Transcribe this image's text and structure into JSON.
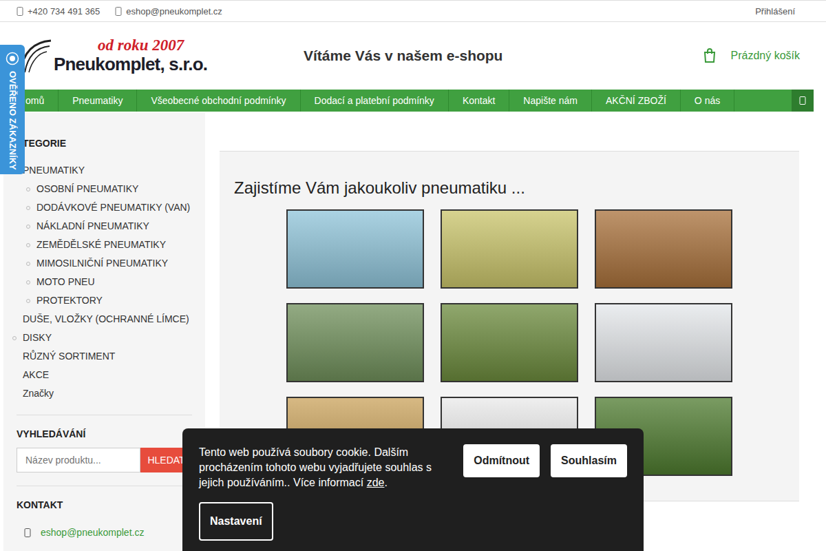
{
  "topbar": {
    "phone": "+420 734 491 365",
    "email": "eshop@pneukomplet.cz",
    "login": "Přihlášení"
  },
  "logo": {
    "tagline": "od roku 2007",
    "name": "Pneukomplet, s.r.o."
  },
  "header": {
    "welcome": "Vítáme Vás v našem e-shopu",
    "cart": "Prázdný košík"
  },
  "badge": {
    "label": "OVĚŘENO ZÁKAZNÍKY"
  },
  "nav": {
    "items": [
      {
        "label": "omů",
        "selected": false
      },
      {
        "label": "Pneumatiky",
        "selected": false
      },
      {
        "label": "Všeobecné obchodní podmínky",
        "selected": false
      },
      {
        "label": "Dodací a platební podmínky",
        "selected": false
      },
      {
        "label": "Kontakt",
        "selected": false
      },
      {
        "label": "Napište nám",
        "selected": false
      },
      {
        "label": "AKČNÍ ZBOŽÍ",
        "selected": false
      },
      {
        "label": "O nás",
        "selected": false
      }
    ]
  },
  "sidebar": {
    "categories_title": "ATEGORIE",
    "categories": [
      {
        "label": "PNEUMATIKY",
        "has_children": true,
        "expanded": true,
        "children": [
          {
            "label": "OSOBNÍ PNEUMATIKY",
            "has_children": true
          },
          {
            "label": "DODÁVKOVÉ PNEUMATIKY (VAN)",
            "has_children": true
          },
          {
            "label": "NÁKLADNÍ PNEUMATIKY",
            "has_children": true
          },
          {
            "label": "ZEMĚDĚLSKÉ PNEUMATIKY",
            "has_children": true
          },
          {
            "label": "MIMOSILNIČNÍ PNEUMATIKY",
            "has_children": true
          },
          {
            "label": "MOTO PNEU",
            "has_children": true
          },
          {
            "label": "PROTEKTORY",
            "has_children": true
          }
        ]
      },
      {
        "label": "DUŠE, VLOŽKY (OCHRANNÉ LÍMCE)",
        "has_children": false,
        "expanded": false,
        "children": []
      },
      {
        "label": "DISKY",
        "has_children": true,
        "expanded": false,
        "children": []
      },
      {
        "label": "RŮZNÝ SORTIMENT",
        "has_children": false,
        "expanded": false,
        "children": []
      },
      {
        "label": "AKCE",
        "has_children": false,
        "expanded": false,
        "children": []
      },
      {
        "label": "Značky",
        "has_children": false,
        "expanded": false,
        "children": []
      }
    ],
    "search_title": "VYHLEDÁVÁNÍ",
    "search_placeholder": "Název produktu...",
    "search_button": "HLEDAT",
    "contact_title": "KONTAKT",
    "contact_email": "eshop@pneukomplet.cz"
  },
  "main": {
    "heading": "Zajistíme Vám jakoukoliv pneumatiku ...",
    "tiles": [
      {
        "color": "#8fc4d9"
      },
      {
        "color": "#c9c46a"
      },
      {
        "color": "#a8703a"
      },
      {
        "color": "#6f8f5a"
      },
      {
        "color": "#6b8a3c"
      },
      {
        "color": "#e4e7ea"
      },
      {
        "color": "#c9a15a"
      },
      {
        "color": "#e9e9e9"
      },
      {
        "color": "#4d7a2e"
      }
    ]
  },
  "cookie": {
    "text": "Tento web používá soubory cookie. Dalším procházením tohoto webu vyjadřujete souhlas s jejich používáním.. Více informací ",
    "link": "zde",
    "after": ".",
    "reject": "Odmítnout",
    "accept": "Souhlasím",
    "settings": "Nastavení"
  }
}
